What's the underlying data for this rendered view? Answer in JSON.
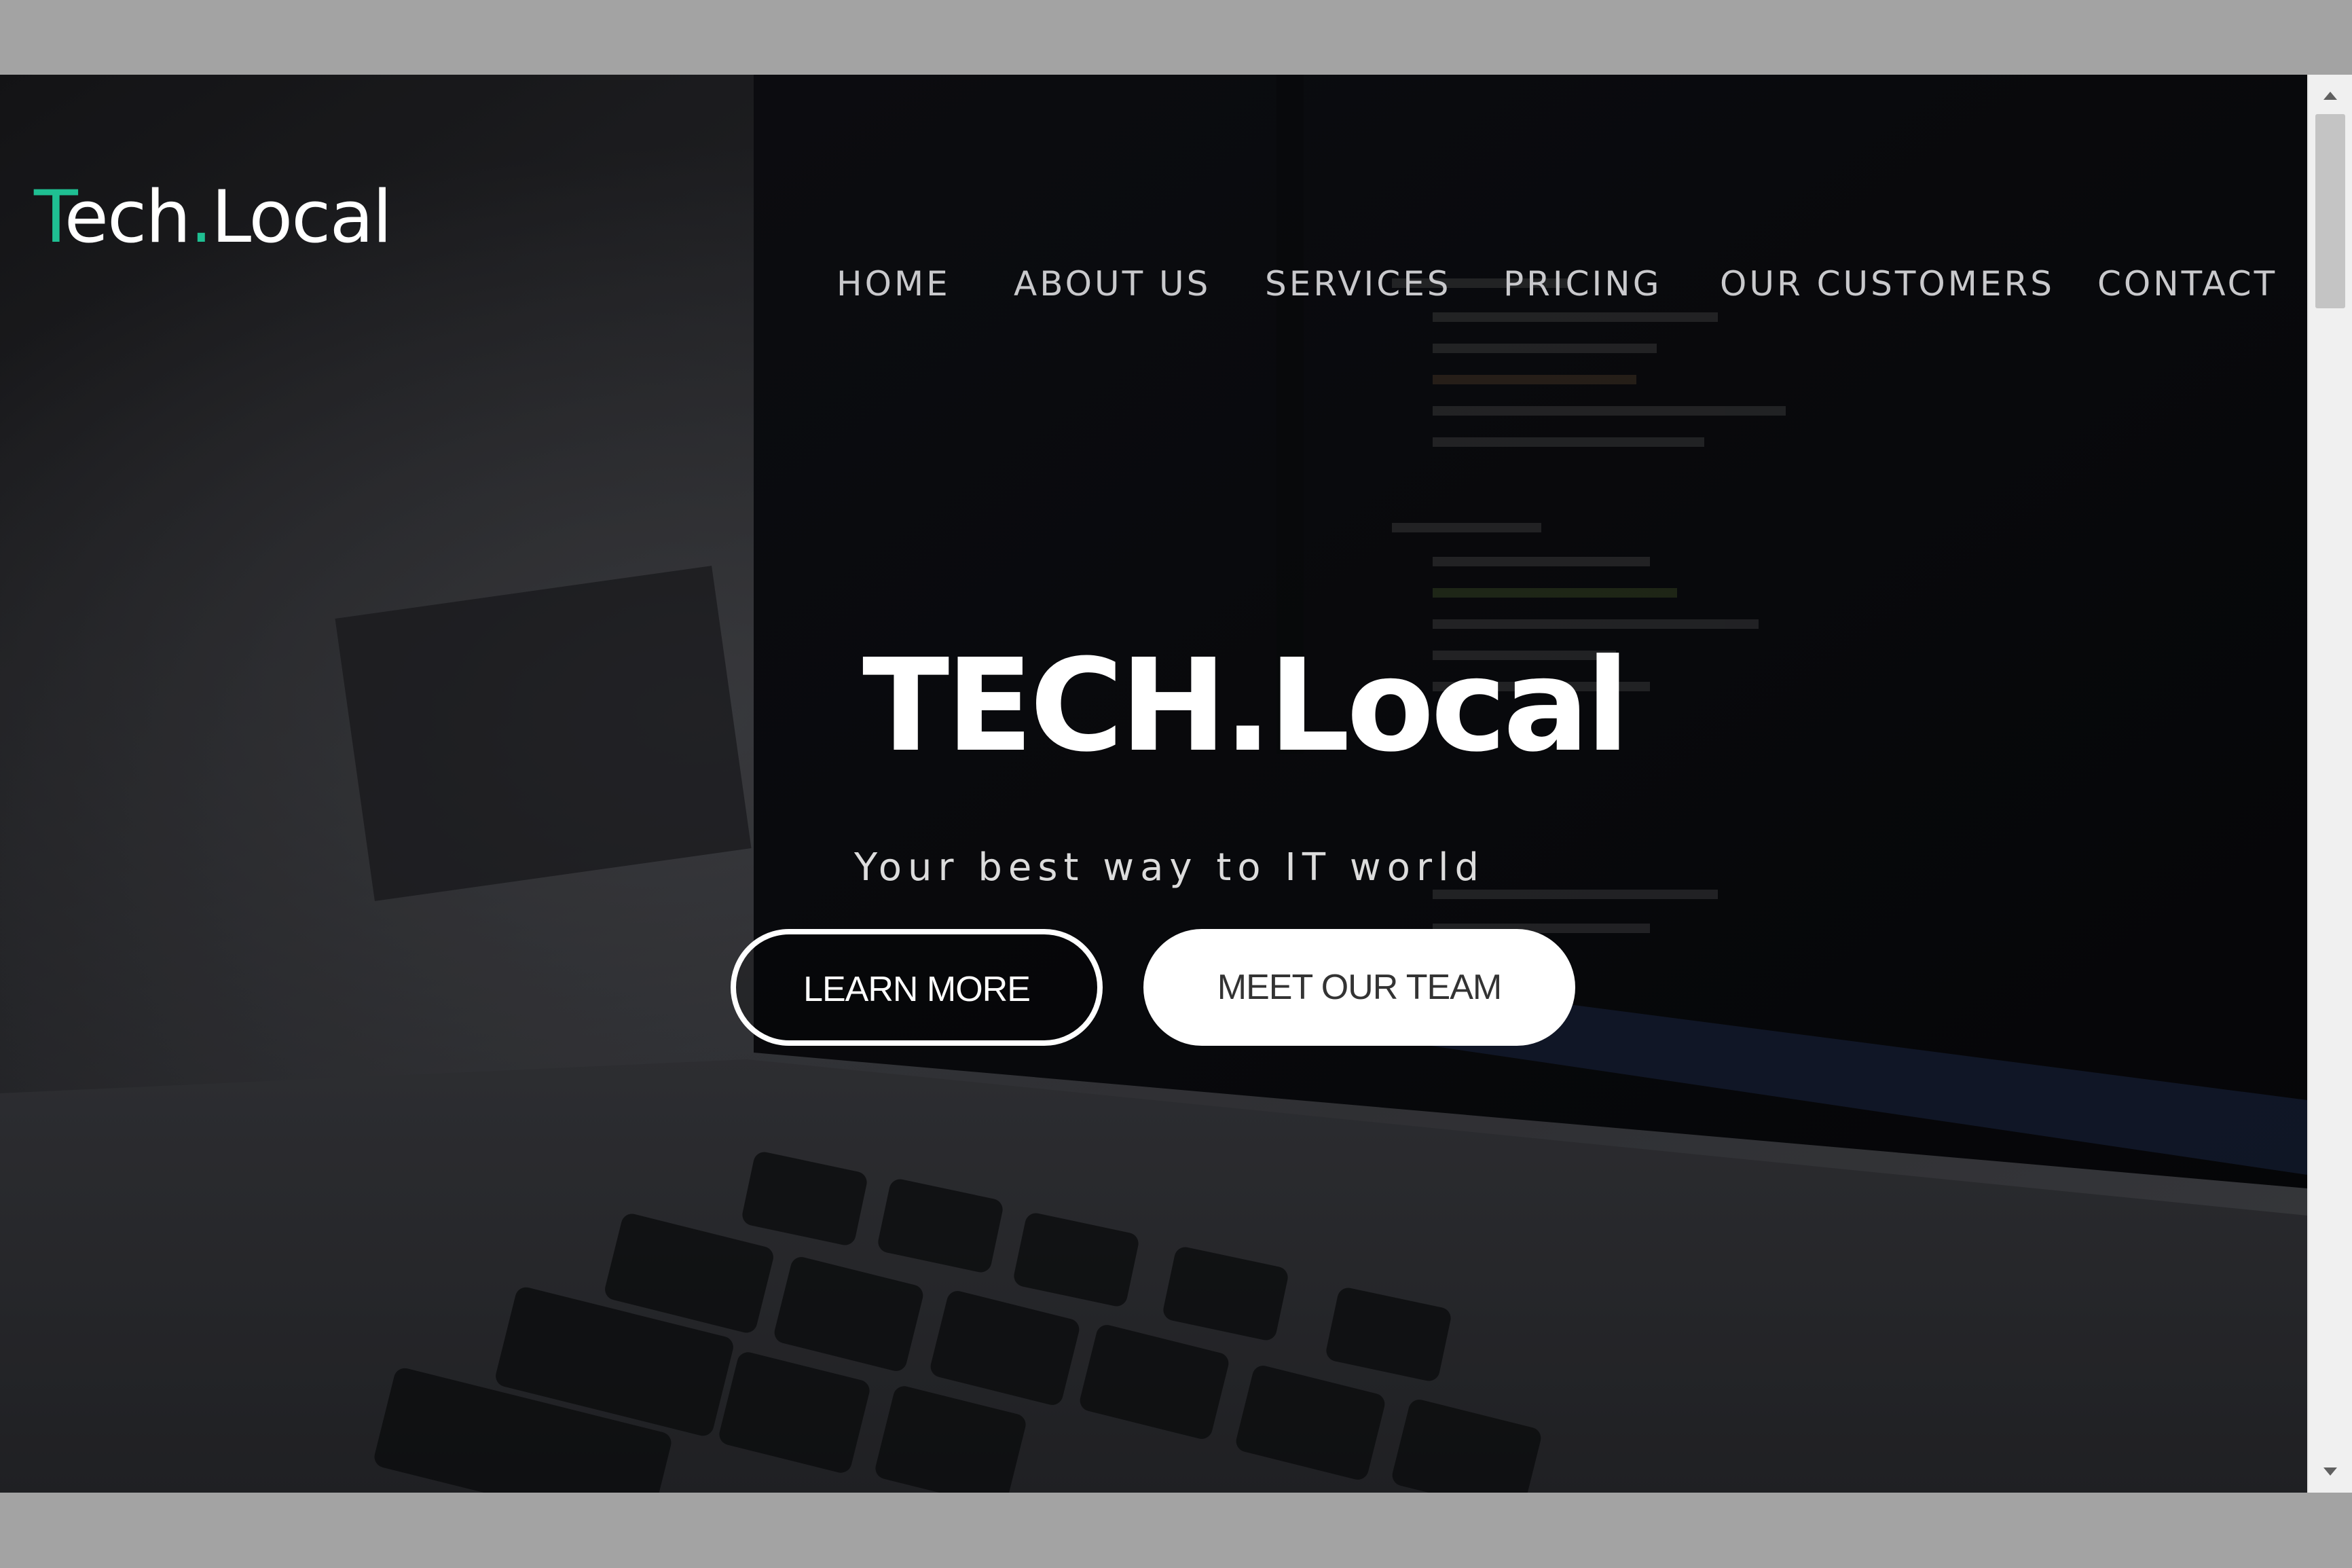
{
  "header": {
    "logo_first": "T",
    "logo_rest": "ech",
    "logo_dot": ".",
    "logo_tail": "Local"
  },
  "nav": {
    "items": [
      {
        "label": "HOME"
      },
      {
        "label": "ABOUT US"
      },
      {
        "label": "SERVICES"
      },
      {
        "label": "PRICING"
      },
      {
        "label": "OUR CUSTOMERS"
      },
      {
        "label": "CONTACT"
      }
    ]
  },
  "hero": {
    "title": "TECH.Local",
    "tagline": "Your best way to IT world",
    "learn_more": "LEARN MORE",
    "meet_team": "MEET OUR TEAM"
  },
  "colors": {
    "accent": "#1fbf92",
    "background": "#0d0e11",
    "nav_text": "#c9c9cc",
    "frame": "#a3a3a3"
  },
  "icons": {
    "scroll_up": "triangle-up-icon",
    "scroll_down": "triangle-down-icon"
  }
}
